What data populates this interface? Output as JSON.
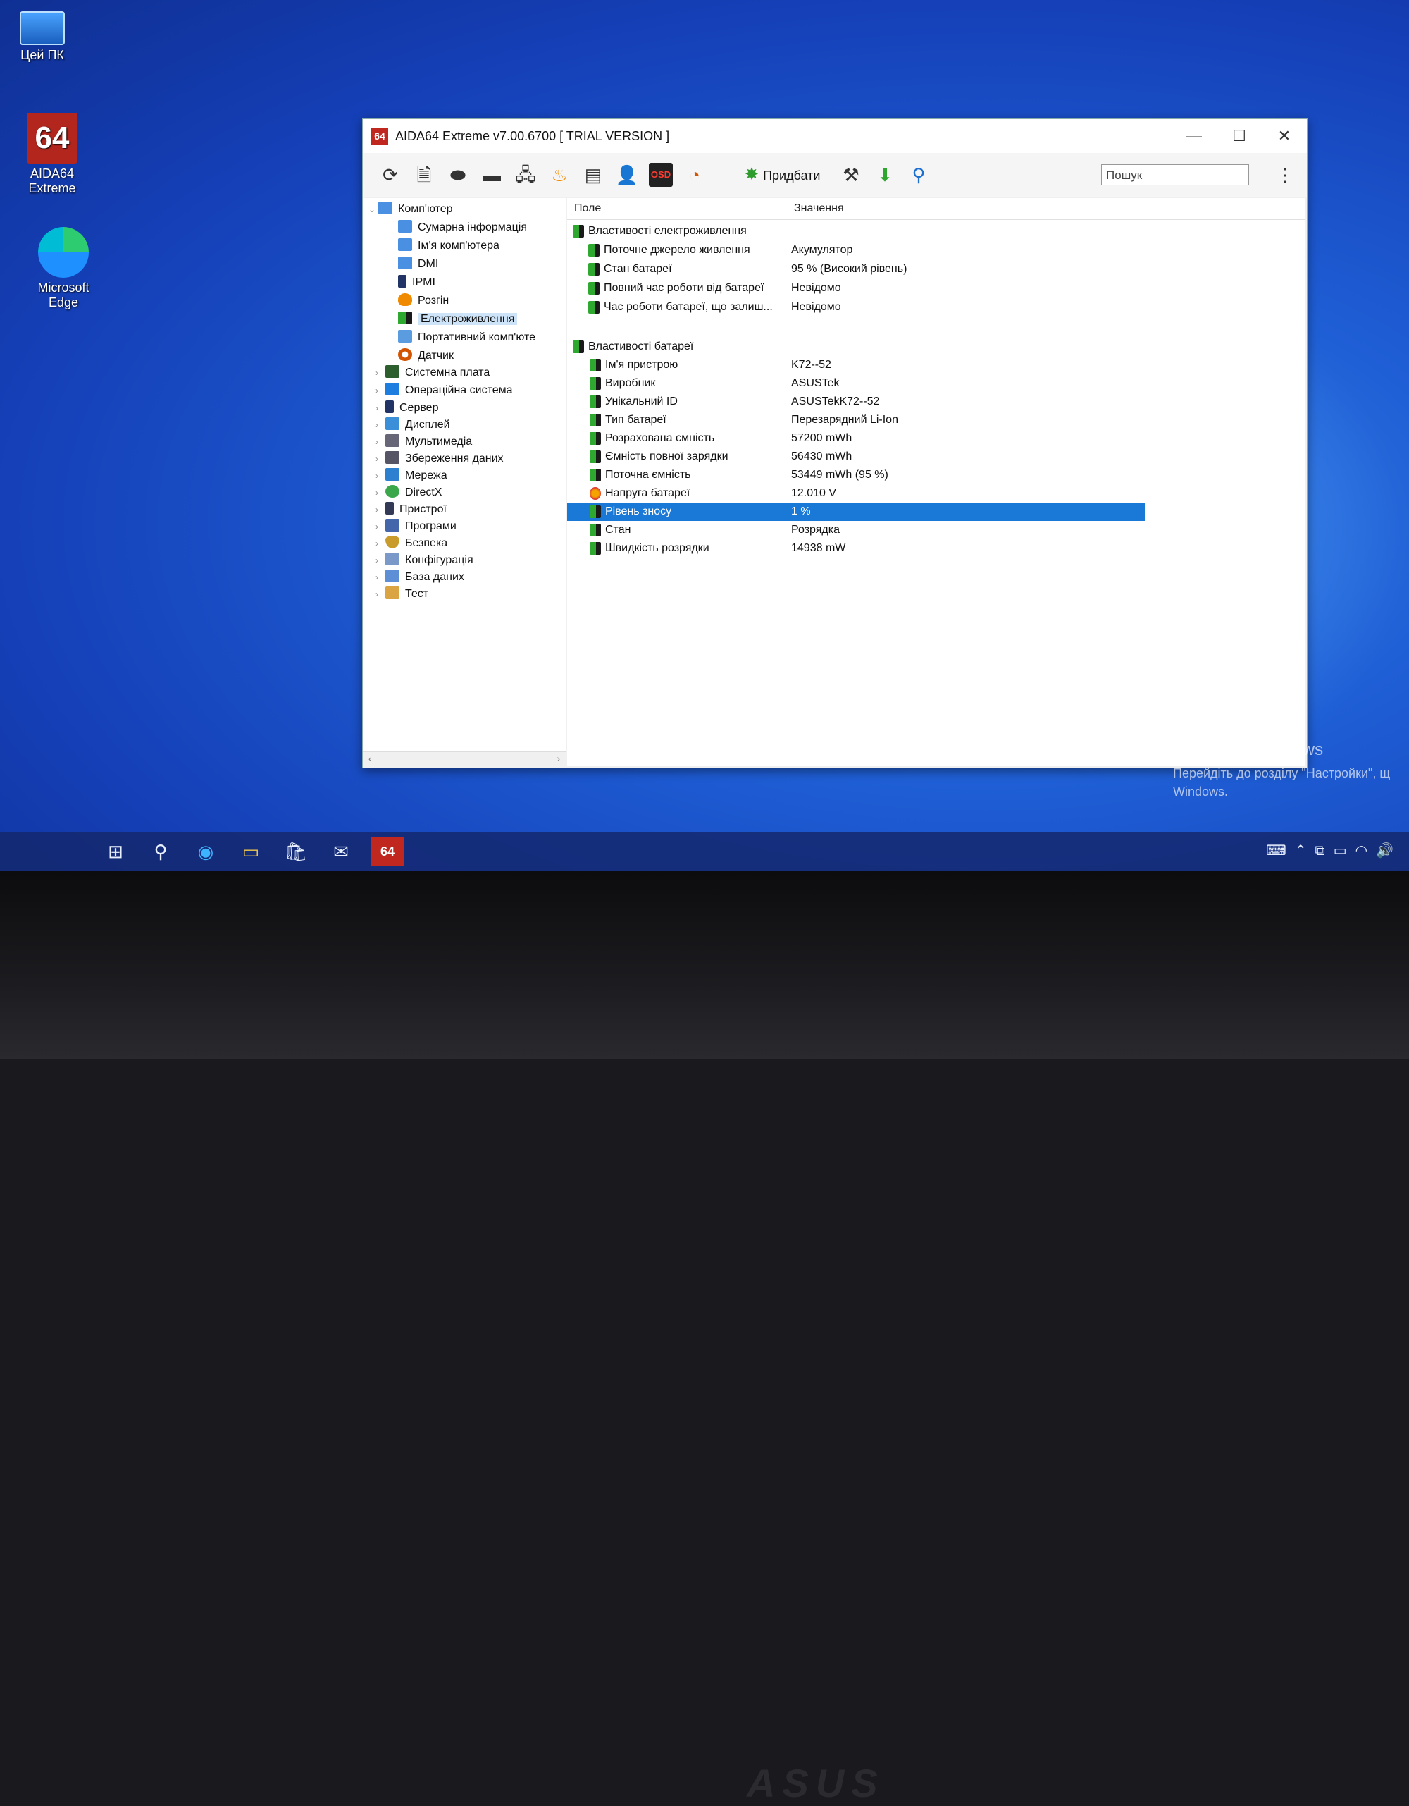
{
  "desktop": {
    "icons": [
      {
        "label": "Цей ПК"
      },
      {
        "label": "AIDA64 Extreme",
        "icon_text": "64"
      },
      {
        "label": "Microsoft Edge"
      }
    ]
  },
  "window": {
    "logo_text": "64",
    "title": "AIDA64 Extreme v7.00.6700  [ TRIAL VERSION ]",
    "controls": {
      "minimize": "—",
      "maximize": "☐",
      "close": "✕"
    }
  },
  "toolbar": {
    "osd_label": "OSD",
    "buy_label": "Придбати",
    "search_placeholder": "Пошук",
    "more_glyph": "⋮"
  },
  "tree": [
    {
      "label": "Комп'ютер",
      "level": 0,
      "expanded": true,
      "icon": "monitor-icon"
    },
    {
      "label": "Сумарна інформація",
      "level": 1,
      "icon": "monitor-icon"
    },
    {
      "label": "Ім'я комп'ютера",
      "level": 1,
      "icon": "monitor-icon"
    },
    {
      "label": "DMI",
      "level": 1,
      "icon": "monitor-icon"
    },
    {
      "label": "IPMI",
      "level": 1,
      "icon": "server-icon"
    },
    {
      "label": "Розгін",
      "level": 1,
      "icon": "flame-icon"
    },
    {
      "label": "Електроживлення",
      "level": 1,
      "icon": "battery-icon",
      "selected": true
    },
    {
      "label": "Портативний комп'юте",
      "level": 1,
      "icon": "laptop-icon"
    },
    {
      "label": "Датчик",
      "level": 1,
      "icon": "gauge-icon"
    },
    {
      "label": "Системна плата",
      "level": 0,
      "icon": "motherboard-icon"
    },
    {
      "label": "Операційна система",
      "level": 0,
      "icon": "windows-icon"
    },
    {
      "label": "Сервер",
      "level": 0,
      "icon": "server-icon"
    },
    {
      "label": "Дисплей",
      "level": 0,
      "icon": "display-icon"
    },
    {
      "label": "Мультимедіа",
      "level": 0,
      "icon": "speaker-icon"
    },
    {
      "label": "Збереження даних",
      "level": 0,
      "icon": "disk-icon"
    },
    {
      "label": "Мережа",
      "level": 0,
      "icon": "network-icon"
    },
    {
      "label": "DirectX",
      "level": 0,
      "icon": "directx-icon"
    },
    {
      "label": "Пристрої",
      "level": 0,
      "icon": "device-icon"
    },
    {
      "label": "Програми",
      "level": 0,
      "icon": "programs-icon"
    },
    {
      "label": "Безпека",
      "level": 0,
      "icon": "shield-icon"
    },
    {
      "label": "Конфігурація",
      "level": 0,
      "icon": "config-icon"
    },
    {
      "label": "База даних",
      "level": 0,
      "icon": "database-icon"
    },
    {
      "label": "Тест",
      "level": 0,
      "icon": "test-icon"
    }
  ],
  "detail": {
    "columns": {
      "field": "Поле",
      "value": "Значення"
    },
    "rows": [
      {
        "field": "Властивості електроживлення",
        "value": "",
        "group": true
      },
      {
        "field": "Поточне джерело живлення",
        "value": "Акумулятор"
      },
      {
        "field": "Стан батареї",
        "value": "95 % (Високий рівень)"
      },
      {
        "field": "Повний час роботи від батареї",
        "value": "Невідомо"
      },
      {
        "field": "Час роботи батареї, що залиш...",
        "value": "Невідомо"
      },
      {
        "field": "",
        "value": "",
        "spacer": true
      },
      {
        "field": "Властивості батареї",
        "value": "",
        "group": true
      },
      {
        "field": "Ім'я пристрою",
        "value": "K72--52"
      },
      {
        "field": "Виробник",
        "value": "ASUSTek"
      },
      {
        "field": "Унікальний ID",
        "value": "ASUSTekK72--52"
      },
      {
        "field": "Тип батареї",
        "value": "Перезарядний Li-Ion"
      },
      {
        "field": "Розрахована ємність",
        "value": "57200 mWh"
      },
      {
        "field": "Ємність повної зарядки",
        "value": "56430 mWh"
      },
      {
        "field": "Поточна ємність",
        "value": "53449 mWh  (95 %)"
      },
      {
        "field": "Напруга батареї",
        "value": "12.010 V",
        "icon": "voltage-icon"
      },
      {
        "field": "Рівень зносу",
        "value": "1 %",
        "selected": true
      },
      {
        "field": "Стан",
        "value": "Розрядка"
      },
      {
        "field": "Швидкість розрядки",
        "value": "14938 mW"
      }
    ]
  },
  "watermark": {
    "title": "Активація Windows",
    "line1": "Перейдіть до розділу \"Настройки\", щ",
    "line2": "Windows."
  },
  "taskbar": {
    "aida_label": "64"
  },
  "bezel": {
    "brand": "ASUS"
  },
  "colors": {
    "selection": "#1a78d6",
    "tree_selection": "#cde3f8",
    "aida_red": "#c0271e"
  }
}
